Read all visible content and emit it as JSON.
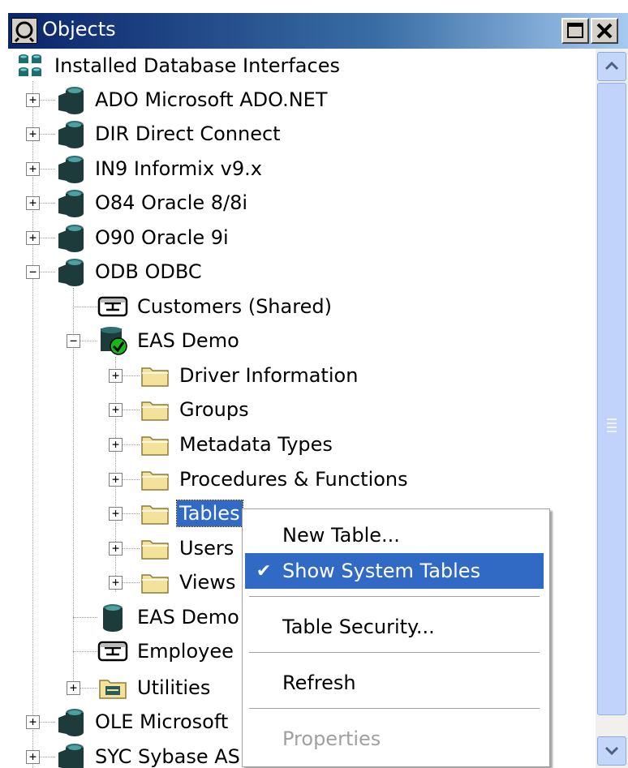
{
  "window": {
    "title": "Objects"
  },
  "tree": {
    "root": "Installed Database Interfaces",
    "items": [
      {
        "label": "ADO Microsoft ADO.NET",
        "expander": "+"
      },
      {
        "label": "DIR Direct Connect",
        "expander": "+"
      },
      {
        "label": "IN9 Informix v9.x",
        "expander": "+"
      },
      {
        "label": "O84 Oracle 8/8i",
        "expander": "+"
      },
      {
        "label": "O90 Oracle 9i",
        "expander": "+"
      },
      {
        "label": "ODB ODBC",
        "expander": "−"
      },
      {
        "label": "Customers (Shared)"
      },
      {
        "label": "EAS Demo",
        "expander": "−"
      },
      {
        "label": "Driver Information",
        "expander": "+"
      },
      {
        "label": "Groups",
        "expander": "+"
      },
      {
        "label": "Metadata Types",
        "expander": "+"
      },
      {
        "label": "Procedures & Functions",
        "expander": "+"
      },
      {
        "label": "Tables",
        "expander": "+"
      },
      {
        "label": "Users",
        "expander": "+"
      },
      {
        "label": "Views",
        "expander": "+"
      },
      {
        "label": "EAS Demo"
      },
      {
        "label": "Employee"
      },
      {
        "label": "Utilities",
        "expander": "+"
      },
      {
        "label": "OLE Microsoft",
        "expander": "+"
      },
      {
        "label": "SYC Sybase ASE",
        "expander": "+"
      }
    ]
  },
  "context_menu": {
    "items": [
      {
        "label": "New Table...",
        "checked": "",
        "state": "normal"
      },
      {
        "label": "Show System Tables",
        "checked": "✔",
        "state": "highlighted"
      },
      {
        "label": "Table Security...",
        "checked": "",
        "state": "normal"
      },
      {
        "label": "Refresh",
        "checked": "",
        "state": "normal"
      },
      {
        "label": "Properties",
        "checked": "",
        "state": "disabled"
      }
    ]
  },
  "colors": {
    "title_bar": "#0a246a",
    "selection": "#316ac5",
    "folder": "#f5e29a",
    "db_icon": "#1e3b3b",
    "check_green": "#16b816"
  },
  "icons": {
    "title": "objects-icon",
    "root": "database-interfaces-icon",
    "driver": "database-driver-icon",
    "profile": "profile-icon",
    "connected": "connected-database-icon",
    "folder": "folder-icon",
    "database": "database-icon",
    "utilities": "utilities-folder-icon"
  }
}
